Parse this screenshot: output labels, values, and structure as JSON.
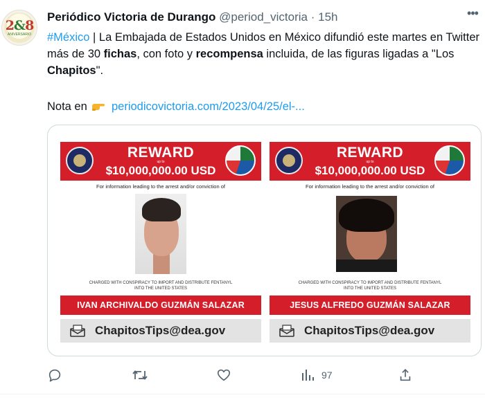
{
  "tweet": {
    "avatar": {
      "number_left": "2",
      "number_mid": "&",
      "number_right": "8",
      "sub": "ANIVERSARIO"
    },
    "author_name": "Periódico Victoria de Durango",
    "handle": "@period_victoria",
    "separator": "·",
    "time": "15h",
    "more_icon": "more-horizontal-icon",
    "text": {
      "hashtag": "#México",
      "part1": " | La Embajada de Estados Unidos en México difundió este martes en Twitter más de 30 ",
      "bold1": "fichas",
      "part2": ", con foto y ",
      "bold2": "recompensa",
      "part3": " incluida, de las figuras ligadas a \"Los ",
      "bold3": "Chapitos",
      "part4": "\"."
    },
    "note": {
      "prefix": "Nota en",
      "icon": "pointing-hand-icon",
      "link": "periodicovictoria.com/2023/04/25/el-..."
    }
  },
  "posters": [
    {
      "reward_title": "REWARD",
      "up_to": "up to",
      "amount": "$10,000,000.00 USD",
      "info": "For information leading to the arrest and/or conviction of",
      "charge_1": "CHARGED WITH CONSPIRACY TO IMPORT AND DISTRIBUTE FENTANYL",
      "charge_2": "INTO THE UNITED STATES",
      "name": "IVAN ARCHIVALDO GUZMÁN SALAZAR",
      "email": "ChapitosTips@dea.gov"
    },
    {
      "reward_title": "REWARD",
      "up_to": "up to",
      "amount": "$10,000,000.00 USD",
      "info": "For information leading to the arrest and/or conviction of",
      "charge_1": "CHARGED WITH CONSPIRACY TO IMPORT AND DISTRIBUTE FENTANYL",
      "charge_2": "INTO THE UNITED STATES",
      "name": "JESUS ALFREDO GUZMÁN SALAZAR",
      "email": "ChapitosTips@dea.gov"
    }
  ],
  "actions": {
    "reply_icon": "reply-icon",
    "retweet_icon": "retweet-icon",
    "like_icon": "heart-icon",
    "views_icon": "views-icon",
    "views_count": "97",
    "share_icon": "share-icon"
  },
  "colors": {
    "link": "#1d9bf0",
    "poster_red": "#d41f2b",
    "muted": "#536471"
  }
}
